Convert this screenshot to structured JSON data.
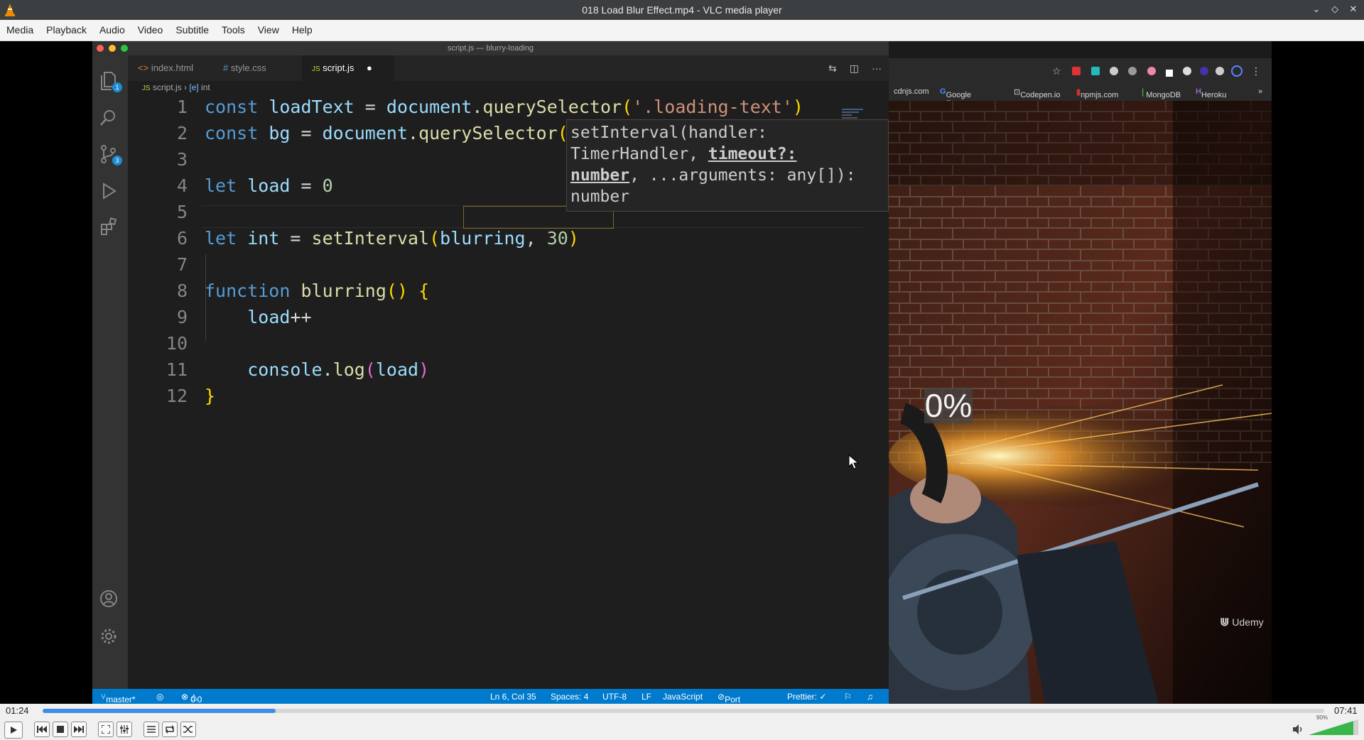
{
  "window": {
    "title": "018 Load Blur Effect.mp4 - VLC media player",
    "controls": [
      "minimize",
      "maximize",
      "close"
    ]
  },
  "menu": [
    "Media",
    "Playback",
    "Audio",
    "Video",
    "Subtitle",
    "Tools",
    "View",
    "Help"
  ],
  "editor": {
    "window_title": "script.js — blurry-loading",
    "tabs": [
      {
        "icon": "<>",
        "label": "index.html"
      },
      {
        "icon": "#",
        "label": "style.css"
      },
      {
        "icon": "JS",
        "label": "script.js"
      }
    ],
    "breadcrumb": {
      "file": "script.js",
      "symbol": "int"
    },
    "badges": {
      "explorer": "1",
      "scm": "3"
    },
    "line_numbers": [
      "1",
      "2",
      "3",
      "4",
      "5",
      "6",
      "7",
      "8",
      "9",
      "10",
      "11",
      "12"
    ],
    "tooltip": {
      "line1": "setInterval(handler:",
      "line2a": "TimerHandler, ",
      "line2b": "timeout?:",
      "line3a": "number",
      "line3b": ", ...arguments: any[]):",
      "line4": "number"
    },
    "status": {
      "branch": "master*",
      "errors": "0",
      "warnings": "0",
      "position": "Ln 6, Col 35",
      "spaces": "Spaces: 4",
      "encoding": "UTF-8",
      "eol": "LF",
      "language": "JavaScript",
      "port": "Port : 5500",
      "prettier": "Prettier: ✓"
    }
  },
  "browser": {
    "bookmarks": [
      "cdnjs.com",
      "Google Fonts",
      "Codepen.io",
      "npmjs.com",
      "MongoDB",
      "Heroku"
    ],
    "overlay_text": "0%",
    "watermark": "Udemy"
  },
  "player": {
    "elapsed": "01:24",
    "total": "07:41",
    "progress": 0.182,
    "volume": "90%"
  }
}
